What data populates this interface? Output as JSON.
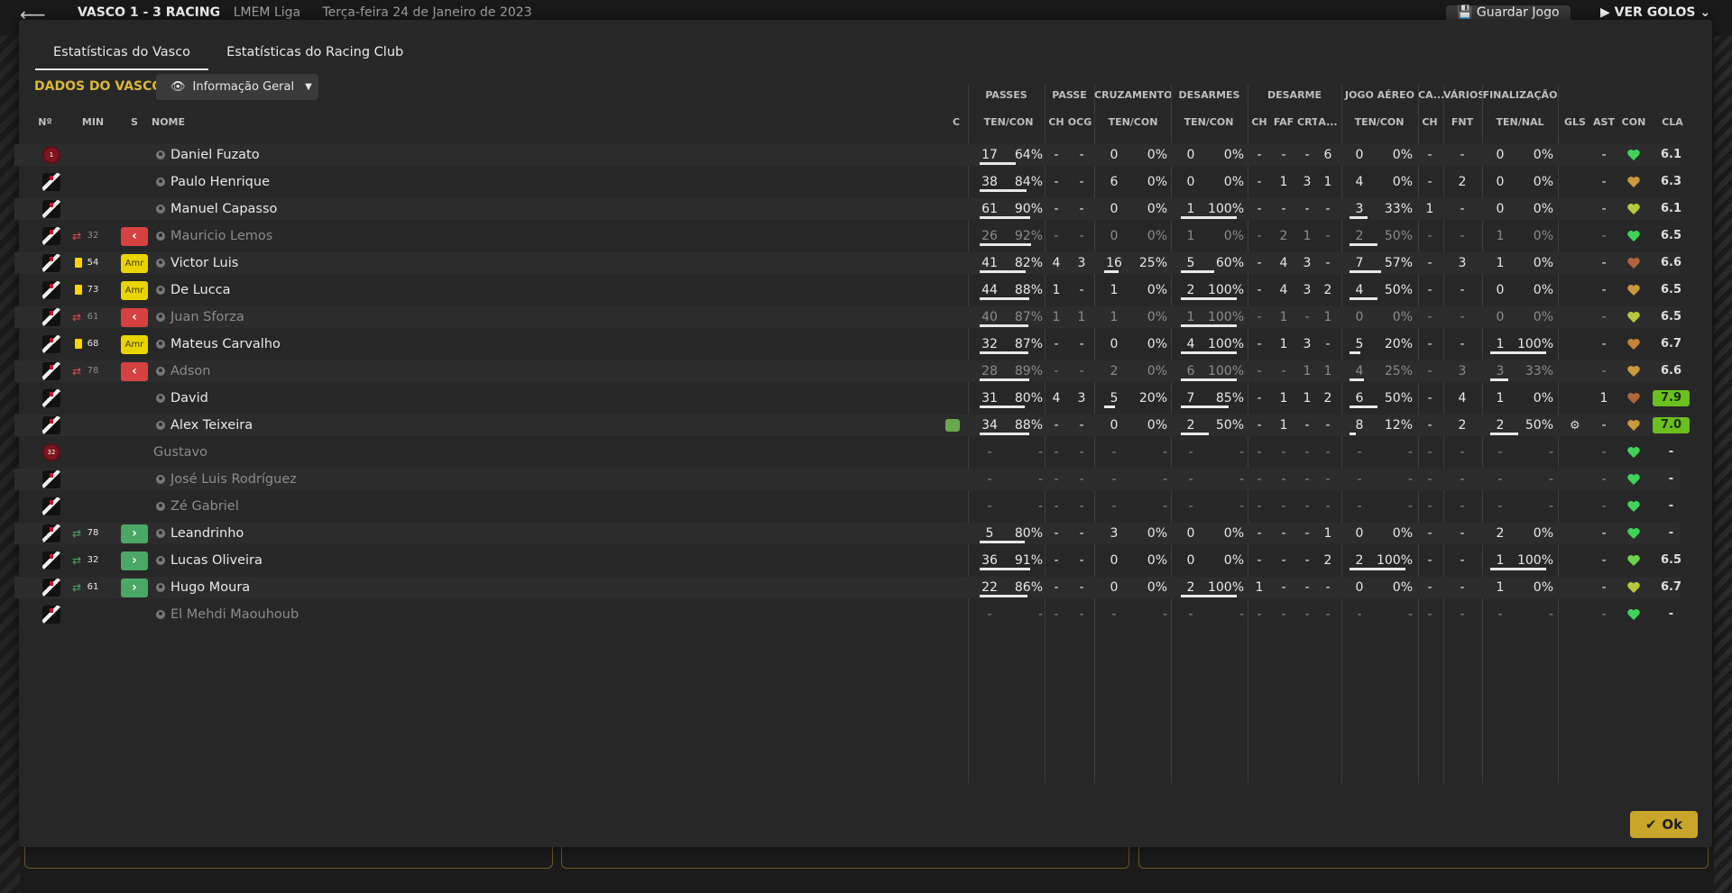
{
  "topbar": {
    "match": "VASCO 1 - 3 RACING",
    "competition": "LMEM Liga",
    "date": "Terça-feira 24 de Janeiro de 2023",
    "save_label": "Guardar Jogo",
    "goals_label": "VER GOLOS"
  },
  "tabs": [
    {
      "label": "Estatísticas do Vasco",
      "active": true
    },
    {
      "label": "Estatísticas do Racing Club",
      "active": false
    }
  ],
  "section": {
    "label": "DADOS DO VASCO",
    "dropdown": "Informação Geral"
  },
  "groups": [
    "PASSES",
    "PASSE",
    "CRUZAMENTOS",
    "DESARMES",
    "DESARME",
    "JOGO AÉREO",
    "CA...",
    "VÁRIOS",
    "FINALIZAÇÃO"
  ],
  "columns": [
    "Nº",
    "MIN",
    "S",
    "NOME",
    "C",
    "TEN/CON",
    "CH",
    "OCG",
    "TEN/CON",
    "TEN/CON",
    "CH",
    "FAF",
    "CRT",
    "A...",
    "TEN/CON",
    "CH",
    "FNT",
    "TEN/NAL",
    "GLS",
    "AST",
    "CON",
    "CLA"
  ],
  "players": [
    {
      "kit": "1",
      "min": "",
      "sub": "",
      "badge": "",
      "name": "Daniel Fuzato",
      "dim": false,
      "c": "",
      "pass": [
        "17",
        "64%"
      ],
      "pbar": 0.64,
      "ch": "-",
      "ocg": "-",
      "cruz": [
        "0",
        "0%"
      ],
      "cbar": 0,
      "des": [
        "0",
        "0%"
      ],
      "dbar": 0,
      "dch": "-",
      "faf": "-",
      "crt": "-",
      "a": "6",
      "aer": [
        "0",
        "0%"
      ],
      "abar": 0,
      "ca": "-",
      "fnt": "-",
      "fin": [
        "0",
        "0%"
      ],
      "fbar": 0,
      "gls": "",
      "ast": "-",
      "con": "#3fd35a",
      "cla": "6.1",
      "hi": false
    },
    {
      "kit": "",
      "min": "",
      "sub": "",
      "badge": "",
      "name": "Paulo Henrique",
      "dim": false,
      "c": "",
      "pass": [
        "38",
        "84%"
      ],
      "pbar": 0.84,
      "ch": "-",
      "ocg": "-",
      "cruz": [
        "6",
        "0%"
      ],
      "cbar": 0,
      "des": [
        "0",
        "0%"
      ],
      "dbar": 0,
      "dch": "-",
      "faf": "1",
      "crt": "3",
      "a": "1",
      "aer": [
        "4",
        "0%"
      ],
      "abar": 0,
      "ca": "-",
      "fnt": "2",
      "fin": [
        "0",
        "0%"
      ],
      "fbar": 0,
      "gls": "",
      "ast": "-",
      "con": "#c79a3a",
      "cla": "6.3",
      "hi": false
    },
    {
      "kit": "",
      "min": "",
      "sub": "",
      "badge": "",
      "name": "Manuel Capasso",
      "dim": false,
      "c": "",
      "pass": [
        "61",
        "90%"
      ],
      "pbar": 0.9,
      "ch": "-",
      "ocg": "-",
      "cruz": [
        "0",
        "0%"
      ],
      "cbar": 0,
      "des": [
        "1",
        "100%"
      ],
      "dbar": 1,
      "dch": "-",
      "faf": "-",
      "crt": "-",
      "a": "-",
      "aer": [
        "3",
        "33%"
      ],
      "abar": 0.33,
      "ca": "1",
      "fnt": "-",
      "fin": [
        "0",
        "0%"
      ],
      "fbar": 0,
      "gls": "",
      "ast": "-",
      "con": "#b7c93a",
      "cla": "6.1",
      "hi": false
    },
    {
      "kit": "",
      "min": "32",
      "sub": "out",
      "badge": "out",
      "name": "Mauricio Lemos",
      "dim": true,
      "c": "",
      "pass": [
        "26",
        "92%"
      ],
      "pbar": 0.92,
      "ch": "-",
      "ocg": "-",
      "cruz": [
        "0",
        "0%"
      ],
      "cbar": 0,
      "des": [
        "1",
        "0%"
      ],
      "dbar": 0,
      "dch": "-",
      "faf": "2",
      "crt": "1",
      "a": "-",
      "aer": [
        "2",
        "50%"
      ],
      "abar": 0.5,
      "ca": "-",
      "fnt": "-",
      "fin": [
        "1",
        "0%"
      ],
      "fbar": 0,
      "gls": "",
      "ast": "-",
      "con": "#3fd35a",
      "cla": "6.5",
      "hi": false
    },
    {
      "kit": "",
      "min": "54",
      "sub": "card",
      "badge": "amr",
      "name": "Victor Luis",
      "dim": false,
      "c": "",
      "pass": [
        "41",
        "82%"
      ],
      "pbar": 0.82,
      "ch": "4",
      "ocg": "3",
      "cruz": [
        "16",
        "25%"
      ],
      "cbar": 0.25,
      "des": [
        "5",
        "60%"
      ],
      "dbar": 0.6,
      "dch": "-",
      "faf": "4",
      "crt": "3",
      "a": "-",
      "aer": [
        "7",
        "57%"
      ],
      "abar": 0.57,
      "ca": "-",
      "fnt": "3",
      "fin": [
        "1",
        "0%"
      ],
      "fbar": 0,
      "gls": "",
      "ast": "-",
      "con": "#b0653a",
      "cla": "6.6",
      "hi": false
    },
    {
      "kit": "",
      "min": "73",
      "sub": "card",
      "badge": "amr",
      "name": "De Lucca",
      "dim": false,
      "c": "",
      "pass": [
        "44",
        "88%"
      ],
      "pbar": 0.88,
      "ch": "1",
      "ocg": "-",
      "cruz": [
        "1",
        "0%"
      ],
      "cbar": 0,
      "des": [
        "2",
        "100%"
      ],
      "dbar": 1,
      "dch": "-",
      "faf": "4",
      "crt": "3",
      "a": "2",
      "aer": [
        "4",
        "50%"
      ],
      "abar": 0.5,
      "ca": "-",
      "fnt": "-",
      "fin": [
        "0",
        "0%"
      ],
      "fbar": 0,
      "gls": "",
      "ast": "-",
      "con": "#c79a3a",
      "cla": "6.5",
      "hi": false
    },
    {
      "kit": "",
      "min": "61",
      "sub": "out",
      "badge": "out",
      "name": "Juan Sforza",
      "dim": true,
      "c": "",
      "pass": [
        "40",
        "87%"
      ],
      "pbar": 0.87,
      "ch": "1",
      "ocg": "1",
      "cruz": [
        "1",
        "0%"
      ],
      "cbar": 0,
      "des": [
        "1",
        "100%"
      ],
      "dbar": 1,
      "dch": "-",
      "faf": "1",
      "crt": "-",
      "a": "1",
      "aer": [
        "0",
        "0%"
      ],
      "abar": 0,
      "ca": "-",
      "fnt": "-",
      "fin": [
        "0",
        "0%"
      ],
      "fbar": 0,
      "gls": "",
      "ast": "-",
      "con": "#b7c93a",
      "cla": "6.5",
      "hi": false
    },
    {
      "kit": "",
      "min": "68",
      "sub": "card",
      "badge": "amr",
      "name": "Mateus Carvalho",
      "dim": false,
      "c": "",
      "pass": [
        "32",
        "87%"
      ],
      "pbar": 0.87,
      "ch": "-",
      "ocg": "-",
      "cruz": [
        "0",
        "0%"
      ],
      "cbar": 0,
      "des": [
        "4",
        "100%"
      ],
      "dbar": 1,
      "dch": "-",
      "faf": "1",
      "crt": "3",
      "a": "-",
      "aer": [
        "5",
        "20%"
      ],
      "abar": 0.2,
      "ca": "-",
      "fnt": "-",
      "fin": [
        "1",
        "100%"
      ],
      "fbar": 1,
      "gls": "",
      "ast": "-",
      "con": "#c9823a",
      "cla": "6.7",
      "hi": false
    },
    {
      "kit": "",
      "min": "78",
      "sub": "out",
      "badge": "out",
      "name": "Adson",
      "dim": true,
      "c": "",
      "pass": [
        "28",
        "89%"
      ],
      "pbar": 0.89,
      "ch": "-",
      "ocg": "-",
      "cruz": [
        "2",
        "0%"
      ],
      "cbar": 0,
      "des": [
        "6",
        "100%"
      ],
      "dbar": 1,
      "dch": "-",
      "faf": "-",
      "crt": "1",
      "a": "1",
      "aer": [
        "4",
        "25%"
      ],
      "abar": 0.25,
      "ca": "-",
      "fnt": "3",
      "fin": [
        "3",
        "33%"
      ],
      "fbar": 0.33,
      "gls": "",
      "ast": "-",
      "con": "#c79a3a",
      "cla": "6.6",
      "hi": false
    },
    {
      "kit": "",
      "min": "",
      "sub": "",
      "badge": "",
      "name": "David",
      "dim": false,
      "c": "",
      "pass": [
        "31",
        "80%"
      ],
      "pbar": 0.8,
      "ch": "4",
      "ocg": "3",
      "cruz": [
        "5",
        "20%"
      ],
      "cbar": 0.2,
      "des": [
        "7",
        "85%"
      ],
      "dbar": 0.85,
      "dch": "-",
      "faf": "1",
      "crt": "1",
      "a": "2",
      "aer": [
        "6",
        "50%"
      ],
      "abar": 0.5,
      "ca": "-",
      "fnt": "4",
      "fin": [
        "1",
        "0%"
      ],
      "fbar": 0,
      "gls": "",
      "ast": "1",
      "con": "#b0653a",
      "cla": "7.9",
      "hi": true
    },
    {
      "kit": "",
      "min": "",
      "sub": "",
      "badge": "",
      "name": "Alex Teixeira",
      "dim": false,
      "c": "bubble",
      "pass": [
        "34",
        "88%"
      ],
      "pbar": 0.88,
      "ch": "-",
      "ocg": "-",
      "cruz": [
        "0",
        "0%"
      ],
      "cbar": 0,
      "des": [
        "2",
        "50%"
      ],
      "dbar": 0.5,
      "dch": "-",
      "faf": "1",
      "crt": "-",
      "a": "-",
      "aer": [
        "8",
        "12%"
      ],
      "abar": 0.12,
      "ca": "-",
      "fnt": "2",
      "fin": [
        "2",
        "50%"
      ],
      "fbar": 0.5,
      "gls": "gear",
      "ast": "-",
      "con": "#c79a3a",
      "cla": "7.0",
      "hi": true
    },
    {
      "kit": "32",
      "min": "",
      "sub": "",
      "badge": "",
      "name": "Gustavo",
      "dim": true,
      "noicon": true,
      "c": "",
      "pass": [
        "-",
        "-"
      ],
      "pbar": 0,
      "ch": "-",
      "ocg": "-",
      "cruz": [
        "-",
        "-"
      ],
      "cbar": 0,
      "des": [
        "-",
        "-"
      ],
      "dbar": 0,
      "dch": "-",
      "faf": "-",
      "crt": "-",
      "a": "-",
      "aer": [
        "-",
        "-"
      ],
      "abar": 0,
      "ca": "-",
      "fnt": "-",
      "fin": [
        "-",
        "-"
      ],
      "fbar": 0,
      "gls": "",
      "ast": "-",
      "con": "#3fd35a",
      "cla": "-",
      "hi": false
    },
    {
      "kit": "",
      "min": "",
      "sub": "",
      "badge": "",
      "name": "José Luis Rodríguez",
      "dim": true,
      "c": "",
      "pass": [
        "-",
        "-"
      ],
      "pbar": 0,
      "ch": "-",
      "ocg": "-",
      "cruz": [
        "-",
        "-"
      ],
      "cbar": 0,
      "des": [
        "-",
        "-"
      ],
      "dbar": 0,
      "dch": "-",
      "faf": "-",
      "crt": "-",
      "a": "-",
      "aer": [
        "-",
        "-"
      ],
      "abar": 0,
      "ca": "-",
      "fnt": "-",
      "fin": [
        "-",
        "-"
      ],
      "fbar": 0,
      "gls": "",
      "ast": "-",
      "con": "#3fd35a",
      "cla": "-",
      "hi": false
    },
    {
      "kit": "",
      "min": "",
      "sub": "",
      "badge": "",
      "name": "Zé Gabriel",
      "dim": true,
      "c": "",
      "pass": [
        "-",
        "-"
      ],
      "pbar": 0,
      "ch": "-",
      "ocg": "-",
      "cruz": [
        "-",
        "-"
      ],
      "cbar": 0,
      "des": [
        "-",
        "-"
      ],
      "dbar": 0,
      "dch": "-",
      "faf": "-",
      "crt": "-",
      "a": "-",
      "aer": [
        "-",
        "-"
      ],
      "abar": 0,
      "ca": "-",
      "fnt": "-",
      "fin": [
        "-",
        "-"
      ],
      "fbar": 0,
      "gls": "",
      "ast": "-",
      "con": "#3fd35a",
      "cla": "-",
      "hi": false
    },
    {
      "kit": "",
      "min": "78",
      "sub": "in",
      "badge": "in",
      "name": "Leandrinho",
      "dim": false,
      "c": "",
      "pass": [
        "5",
        "80%"
      ],
      "pbar": 0.8,
      "ch": "-",
      "ocg": "-",
      "cruz": [
        "3",
        "0%"
      ],
      "cbar": 0,
      "des": [
        "0",
        "0%"
      ],
      "dbar": 0,
      "dch": "-",
      "faf": "-",
      "crt": "-",
      "a": "1",
      "aer": [
        "0",
        "0%"
      ],
      "abar": 0,
      "ca": "-",
      "fnt": "-",
      "fin": [
        "2",
        "0%"
      ],
      "fbar": 0,
      "gls": "",
      "ast": "-",
      "con": "#3fd35a",
      "cla": "-",
      "hi": false
    },
    {
      "kit": "",
      "min": "32",
      "sub": "in",
      "badge": "in",
      "name": "Lucas Oliveira",
      "dim": false,
      "c": "",
      "pass": [
        "36",
        "91%"
      ],
      "pbar": 0.91,
      "ch": "-",
      "ocg": "-",
      "cruz": [
        "0",
        "0%"
      ],
      "cbar": 0,
      "des": [
        "0",
        "0%"
      ],
      "dbar": 0,
      "dch": "-",
      "faf": "-",
      "crt": "-",
      "a": "2",
      "aer": [
        "2",
        "100%"
      ],
      "abar": 1,
      "ca": "-",
      "fnt": "-",
      "fin": [
        "1",
        "100%"
      ],
      "fbar": 1,
      "gls": "",
      "ast": "-",
      "con": "#6ad34a",
      "cla": "6.5",
      "hi": false
    },
    {
      "kit": "",
      "min": "61",
      "sub": "in",
      "badge": "in",
      "name": "Hugo Moura",
      "dim": false,
      "c": "",
      "pass": [
        "22",
        "86%"
      ],
      "pbar": 0.86,
      "ch": "-",
      "ocg": "-",
      "cruz": [
        "0",
        "0%"
      ],
      "cbar": 0,
      "des": [
        "2",
        "100%"
      ],
      "dbar": 1,
      "dch": "1",
      "faf": "-",
      "crt": "-",
      "a": "-",
      "aer": [
        "0",
        "0%"
      ],
      "abar": 0,
      "ca": "-",
      "fnt": "-",
      "fin": [
        "1",
        "0%"
      ],
      "fbar": 0,
      "gls": "",
      "ast": "-",
      "con": "#b7c93a",
      "cla": "6.7",
      "hi": false
    },
    {
      "kit": "",
      "min": "",
      "sub": "",
      "badge": "",
      "name": "El Mehdi Maouhoub",
      "dim": true,
      "c": "",
      "pass": [
        "-",
        "-"
      ],
      "pbar": 0,
      "ch": "-",
      "ocg": "-",
      "cruz": [
        "-",
        "-"
      ],
      "cbar": 0,
      "des": [
        "-",
        "-"
      ],
      "dbar": 0,
      "dch": "-",
      "faf": "-",
      "crt": "-",
      "a": "-",
      "aer": [
        "-",
        "-"
      ],
      "abar": 0,
      "ca": "-",
      "fnt": "-",
      "fin": [
        "-",
        "-"
      ],
      "fbar": 0,
      "gls": "",
      "ast": "-",
      "con": "#3fd35a",
      "cla": "-",
      "hi": false
    }
  ],
  "ok_label": "Ok"
}
